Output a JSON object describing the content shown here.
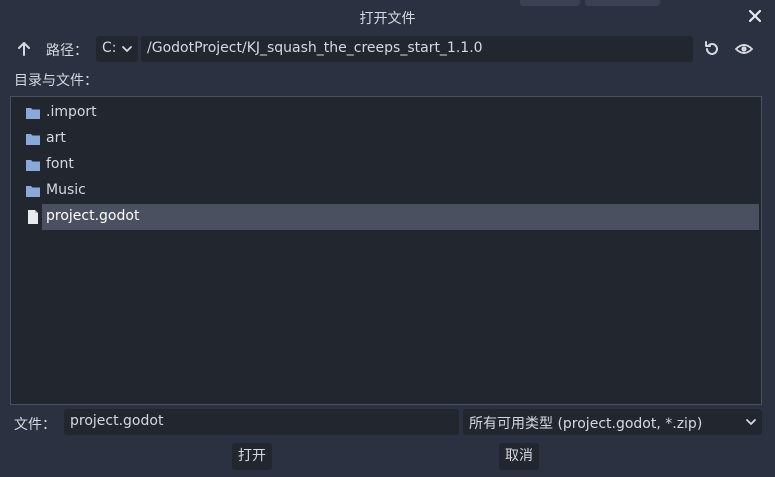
{
  "dialog": {
    "title": "打开文件"
  },
  "path_bar": {
    "label": "路径：",
    "drive": "C:",
    "path": "/GodotProject/KJ_squash_the_creeps_start_1.1.0"
  },
  "browser": {
    "label": "目录与文件：",
    "items": [
      {
        "name": ".import",
        "type": "folder",
        "icon": "folder-icon"
      },
      {
        "name": "art",
        "type": "folder",
        "icon": "folder-icon"
      },
      {
        "name": "font",
        "type": "folder",
        "icon": "folder-icon"
      },
      {
        "name": "Music",
        "type": "folder",
        "icon": "folder-icon"
      },
      {
        "name": "project.godot",
        "type": "file",
        "icon": "file-icon",
        "selected": true
      }
    ]
  },
  "footer": {
    "file_label": "文件：",
    "file_value": "project.godot",
    "filter": "所有可用类型 (project.godot, *.zip)",
    "open_label": "打开",
    "cancel_label": "取消"
  },
  "colors": {
    "background": "#2b3140",
    "field": "#21262f",
    "selection": "#4a5060",
    "folder": "#8aa8d8",
    "text": "#d5d9df"
  }
}
